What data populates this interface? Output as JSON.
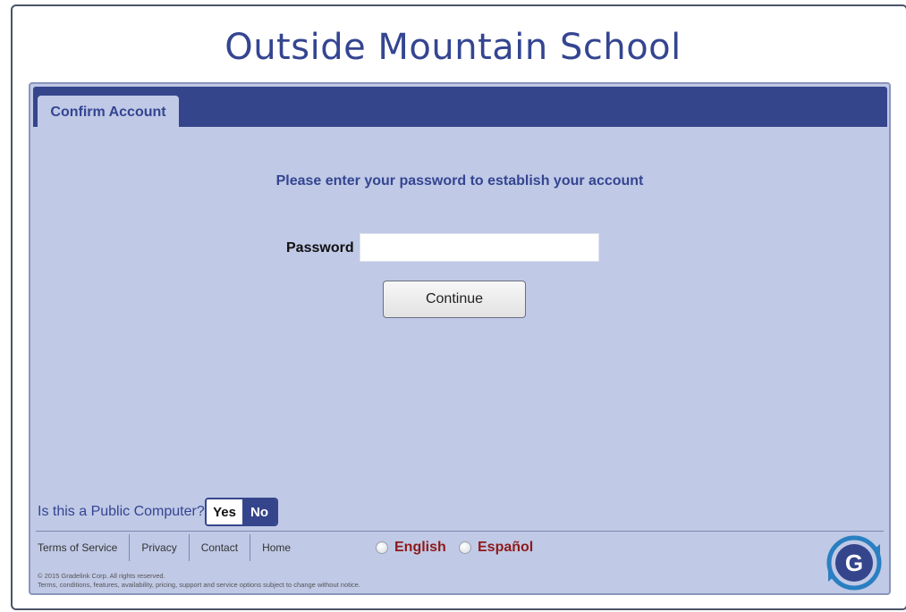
{
  "header": {
    "title": "Outside Mountain School"
  },
  "tabs": [
    {
      "label": "Confirm Account"
    }
  ],
  "form": {
    "prompt": "Please enter your password to establish your account",
    "password_label": "Password",
    "password_value": "",
    "continue_label": "Continue"
  },
  "public_computer": {
    "question": "Is this a Public Computer?",
    "yes_label": "Yes",
    "no_label": "No",
    "selected": "No"
  },
  "footer": {
    "links": [
      "Terms of Service",
      "Privacy",
      "Contact",
      "Home"
    ],
    "languages": [
      {
        "label": "English"
      },
      {
        "label": "Español"
      }
    ],
    "copyright_line1": "© 2015 Gradelink Corp. All rights reserved.",
    "copyright_line2": "Terms, conditions, features, availability, pricing, support and service options subject to change without notice.",
    "logo_letter": "G"
  },
  "colors": {
    "brand_blue": "#35458c",
    "panel_bg": "#c0c9e6",
    "language_red": "#8e1a1a"
  }
}
